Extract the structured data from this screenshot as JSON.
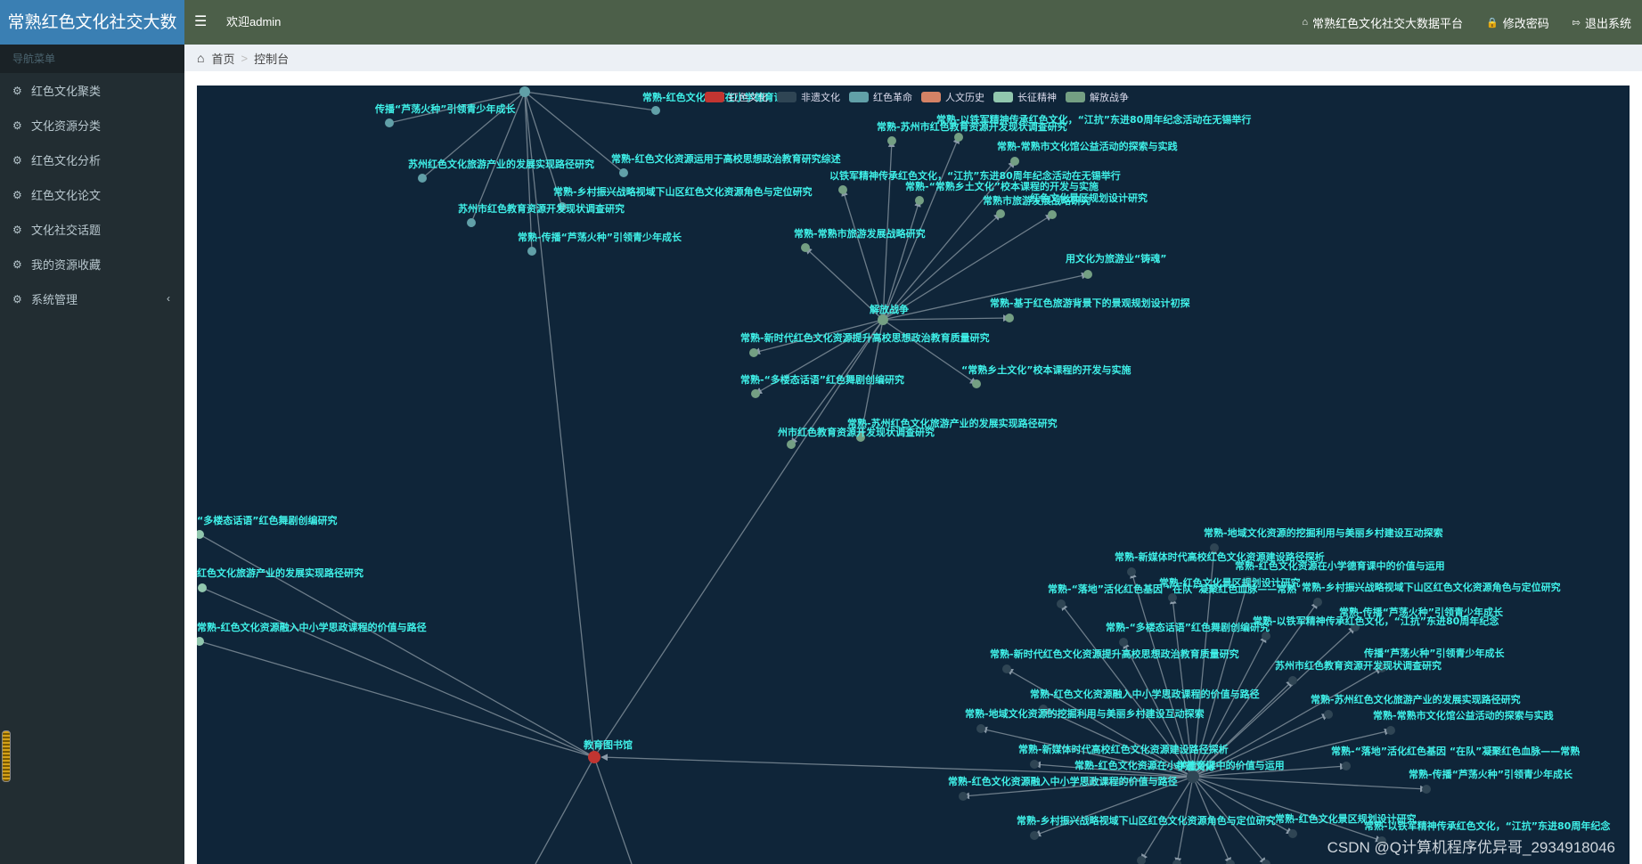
{
  "app": {
    "logo": "常熟红色文化社交大数",
    "welcome": "欢迎admin",
    "nav_right": [
      {
        "icon": "home-icon",
        "label": "常熟红色文化社交大数据平台"
      },
      {
        "icon": "lock-icon",
        "label": "修改密码"
      },
      {
        "icon": "logout-icon",
        "label": "退出系统"
      }
    ]
  },
  "sidebar": {
    "header": "导航菜单",
    "items": [
      {
        "label": "红色文化聚类"
      },
      {
        "label": "文化资源分类"
      },
      {
        "label": "红色文化分析"
      },
      {
        "label": "红色文化论文"
      },
      {
        "label": "文化社交话题"
      },
      {
        "label": "我的资源收藏"
      },
      {
        "label": "系统管理",
        "has_chevron": true
      }
    ]
  },
  "breadcrumb": {
    "home": "首页",
    "current": "控制台"
  },
  "graph": {
    "legend": [
      {
        "label": "红色文化",
        "color": "#c23531"
      },
      {
        "label": "非遗文化",
        "color": "#2f4554"
      },
      {
        "label": "红色革命",
        "color": "#61a0a8"
      },
      {
        "label": "人文历史",
        "color": "#d48265"
      },
      {
        "label": "长征精神",
        "color": "#91c7ae"
      },
      {
        "label": "解放战争",
        "color": "#749f83"
      }
    ],
    "center_labels": [
      "教育图书馆",
      "解放战争",
      "非遗文化"
    ],
    "node_labels": [
      "传播“芦荡火种”引领青少年成长",
      "常熟-红色文化资源在小学德育课...",
      "苏州红色文化旅游产业的发展实现路径研究",
      "常熟-红色文化资源运用于高校思想政治教育研究综述",
      "常熟-乡村振兴战略视域下山区红色文化资源角色与定位研究",
      "苏州市红色教育资源开发现状调查研究",
      "常熟-传播“芦荡火种”引领青少年成长",
      "常熟-苏州市红色教育资源开发现状调查研究",
      "常熟-以铁军精神传承红色文化，“江抗”东进80周年纪念活动在无锡举行",
      "常熟-常熟市文化馆公益活动的探索与实践",
      "以铁军精神传承红色文化，“江抗”东进80周年纪念活动在无锡举行",
      "常熟-“常熟乡土文化”校本课程的开发与实施",
      "常熟市旅游发展战略研究",
      "红色文化景区规划设计研究",
      "常熟-常熟市旅游发展战略研究",
      "用文化为旅游业“铸魂”",
      "常熟-基于红色旅游背景下的景观规划设计初探",
      "常熟-新时代红色文化资源提升高校思想政治教育质量研究",
      "“常熟乡土文化”校本课程的开发与实施",
      "常熟-“多楼态话语”红色舞剧创编研究",
      "常熟-苏州红色文化旅游产业的发展实现路径研究",
      "州市红色教育资源开发现状调查研究",
      "“多楼态话语”红色舞剧创编研究",
      "红色文化旅游产业的发展实现路径研究",
      "常熟-红色文化资源融入中小学思政课程的价值与路径",
      "常熟-地域文化资源的挖掘利用与美丽乡村建设互动探索",
      "常熟-新媒体时代高校红色文化资源建设路径探析",
      "常熟-红色文化资源在小学德育课中的价值与运用",
      "常熟-“落地”活化红色基因 “在队”凝聚红色血脉——常熟",
      "常熟-红色文化景区规划设计研究",
      "常熟-乡村振兴战略视域下山区红色文化资源角色与定位研究",
      "常熟-传播“芦荡火种”引领青少年成长",
      "常熟-以铁军精神传承红色文化，“江抗”东进80周年纪念"
    ]
  },
  "watermark": "CSDN @Q计算机程序优异哥_2934918046"
}
